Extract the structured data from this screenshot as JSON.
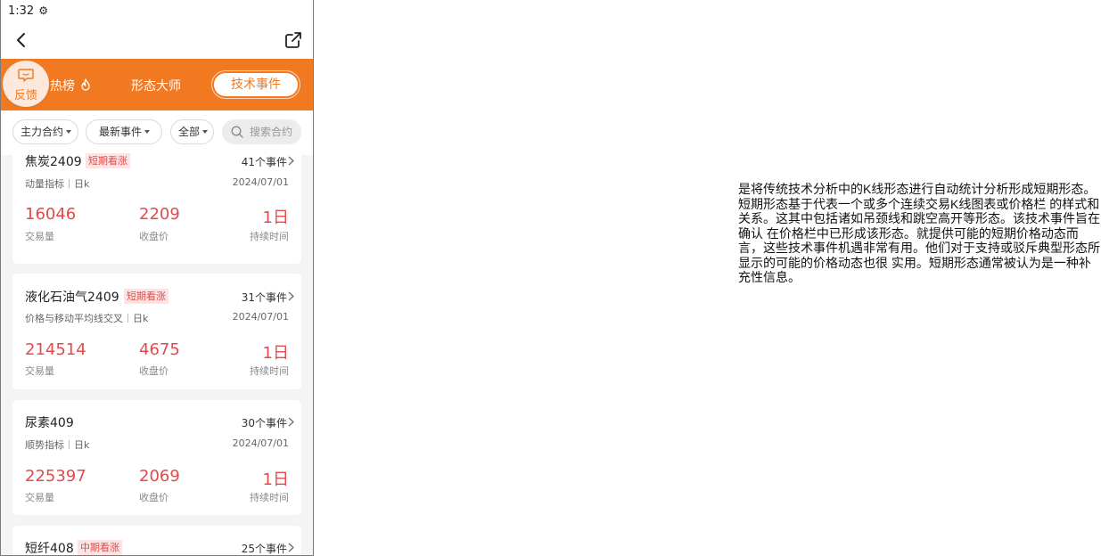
{
  "status_bar": {
    "time": "1:32",
    "settings_icon": "gear-icon"
  },
  "nav": {
    "back_icon": "back-arrow-icon",
    "share_icon": "share-icon"
  },
  "tabs": [
    {
      "label": "热榜",
      "icon": "fire-icon"
    },
    {
      "label": "形态大师"
    },
    {
      "label": "技术事件",
      "active": true
    }
  ],
  "feedback": {
    "label": "反馈",
    "icon": "chat-icon"
  },
  "filters": {
    "contract": "主力合约",
    "latest": "最新事件",
    "all": "全部",
    "search_placeholder": "搜索合约"
  },
  "cards": [
    {
      "name": "焦炭2409",
      "tag": "短期看涨",
      "events": "41个事件",
      "indicator": "动量指标",
      "period": "日k",
      "date": "2024/07/01",
      "volume": "16046",
      "volume_label": "交易量",
      "close": "2209",
      "close_label": "收盘价",
      "duration": "1日",
      "duration_label": "持续时间"
    },
    {
      "name": "液化石油气2409",
      "tag": "短期看涨",
      "events": "31个事件",
      "indicator": "价格与移动平均线交叉",
      "period": "日k",
      "date": "2024/07/01",
      "volume": "214514",
      "volume_label": "交易量",
      "close": "4675",
      "close_label": "收盘价",
      "duration": "1日",
      "duration_label": "持续时间"
    },
    {
      "name": "尿素409",
      "tag": "",
      "events": "30个事件",
      "indicator": "顺势指标",
      "period": "日k",
      "date": "2024/07/01",
      "volume": "225397",
      "volume_label": "交易量",
      "close": "2069",
      "close_label": "收盘价",
      "duration": "1日",
      "duration_label": "持续时间"
    },
    {
      "name": "短纤408",
      "tag": "中期看涨",
      "events": "25个事件"
    }
  ],
  "description": "是将传统技术分析中的K线形态进行自动统计分析形成短期形态。短期形态基于代表一个或多个连续交易K线图表或价格栏 的样式和关系。这其中包括诸如吊颈线和跳空高开等形态。该技术事件旨在确认 在价格栏中已形成该形态。就提供可能的短期价格动态而言，这些技术事件机遇非常有用。他们对于支持或驳斥典型形态所显示的可能的价格动态也很 实用。短期形态通常被认为是一种补充性信息。",
  "colors": {
    "accent": "#f07922",
    "value_red": "#e04b4b",
    "tag_bg": "#fde4e4"
  }
}
